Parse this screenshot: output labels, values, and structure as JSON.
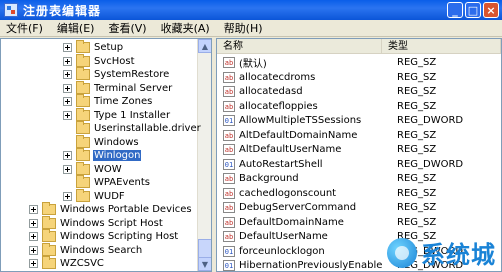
{
  "window": {
    "title": "注册表编辑器"
  },
  "window_buttons": [
    "_",
    "□",
    "×"
  ],
  "menu": [
    "文件(F)",
    "编辑(E)",
    "查看(V)",
    "收藏夹(A)",
    "帮助(H)"
  ],
  "tree": [
    {
      "label": "Setup",
      "level": 2,
      "expander": true
    },
    {
      "label": "SvcHost",
      "level": 2,
      "expander": true
    },
    {
      "label": "SystemRestore",
      "level": 2,
      "expander": true
    },
    {
      "label": "Terminal Server",
      "level": 2,
      "expander": true
    },
    {
      "label": "Time Zones",
      "level": 2,
      "expander": true
    },
    {
      "label": "Type 1 Installer",
      "level": 2,
      "expander": true
    },
    {
      "label": "Userinstallable.driver",
      "level": 2,
      "expander": false
    },
    {
      "label": "Windows",
      "level": 2,
      "expander": false
    },
    {
      "label": "Winlogon",
      "level": 2,
      "expander": true,
      "selected": true
    },
    {
      "label": "WOW",
      "level": 2,
      "expander": true
    },
    {
      "label": "WPAEvents",
      "level": 2,
      "expander": false
    },
    {
      "label": "WUDF",
      "level": 2,
      "expander": true
    },
    {
      "label": "Windows Portable Devices",
      "level": 1,
      "expander": true
    },
    {
      "label": "Windows Script Host",
      "level": 1,
      "expander": true
    },
    {
      "label": "Windows Scripting Host",
      "level": 1,
      "expander": true
    },
    {
      "label": "Windows Search",
      "level": 1,
      "expander": true
    },
    {
      "label": "WZCSVC",
      "level": 1,
      "expander": true
    }
  ],
  "list_headers": {
    "name": "名称",
    "type": "类型"
  },
  "values": [
    {
      "name": "(默认)",
      "type": "REG_SZ",
      "kind": "sz"
    },
    {
      "name": "allocatecdroms",
      "type": "REG_SZ",
      "kind": "sz"
    },
    {
      "name": "allocatedasd",
      "type": "REG_SZ",
      "kind": "sz"
    },
    {
      "name": "allocatefloppies",
      "type": "REG_SZ",
      "kind": "sz"
    },
    {
      "name": "AllowMultipleTSSessions",
      "type": "REG_DWORD",
      "kind": "dword"
    },
    {
      "name": "AltDefaultDomainName",
      "type": "REG_SZ",
      "kind": "sz"
    },
    {
      "name": "AltDefaultUserName",
      "type": "REG_SZ",
      "kind": "sz"
    },
    {
      "name": "AutoRestartShell",
      "type": "REG_DWORD",
      "kind": "dword"
    },
    {
      "name": "Background",
      "type": "REG_SZ",
      "kind": "sz"
    },
    {
      "name": "cachedlogonscount",
      "type": "REG_SZ",
      "kind": "sz"
    },
    {
      "name": "DebugServerCommand",
      "type": "REG_SZ",
      "kind": "sz"
    },
    {
      "name": "DefaultDomainName",
      "type": "REG_SZ",
      "kind": "sz"
    },
    {
      "name": "DefaultUserName",
      "type": "REG_SZ",
      "kind": "sz"
    },
    {
      "name": "forceunlocklogon",
      "type": "REG_DWORD",
      "kind": "dword"
    },
    {
      "name": "HibernationPreviouslyEnable",
      "type": "REG_DWORD",
      "kind": "dword"
    }
  ],
  "icon_text": {
    "sz": "ab",
    "dword": "01"
  },
  "scroll_arrows": {
    "up": "▲",
    "down": "▼"
  },
  "watermark": {
    "text": "系统城"
  }
}
